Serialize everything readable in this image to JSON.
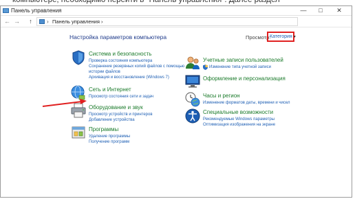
{
  "caption": "компьютере, необходимо перейти в \"Панель управления\". Далее раздел",
  "window": {
    "title": "Панель управления",
    "minimize": "—",
    "maximize": "□",
    "close": "✕"
  },
  "address": {
    "back": "←",
    "forward": "→",
    "up": "↑",
    "separator": "›",
    "path": "Панель управления  ›"
  },
  "main": {
    "heading": "Настройка параметров компьютера",
    "view_label": "Просмотр:",
    "view_value": "Категория",
    "view_chevron": "▾"
  },
  "categories_left": [
    {
      "title": "Система и безопасность",
      "icon": "shield-icon",
      "links": [
        "Проверка состояния компьютера",
        "Сохранение резервных копий файлов с помощью",
        "истории файлов",
        "Архивация и восстановление (Windows 7)"
      ]
    },
    {
      "title": "Сеть и Интернет",
      "icon": "network-globe-icon",
      "links": [
        "Просмотр состояния сети и задач"
      ]
    },
    {
      "title": "Оборудование и звук",
      "icon": "printer-icon",
      "links": [
        "Просмотр устройств и принтеров",
        "Добавление устройства"
      ]
    },
    {
      "title": "Программы",
      "icon": "programs-icon",
      "links": [
        "Удаление программы",
        "Получение программ"
      ]
    }
  ],
  "categories_right": [
    {
      "title": "Учетные записи пользователей",
      "icon": "users-icon",
      "links": [
        "Изменение типа учетной записи"
      ]
    },
    {
      "title": "Оформление и персонализация",
      "icon": "personalization-icon",
      "links": []
    },
    {
      "title": "Часы и регион",
      "icon": "clock-globe-icon",
      "links": [
        "Изменение форматов даты, времени и чисел"
      ]
    },
    {
      "title": "Специальные возможности",
      "icon": "accessibility-icon",
      "links": [
        "Рекомендуемые Windows параметры",
        "Оптимизация изображения на экране"
      ]
    }
  ],
  "colors": {
    "category_title": "#1a7a2a",
    "link": "#1e5fb4",
    "highlight_box": "#e02020",
    "annotation_arrow": "#e02020"
  }
}
